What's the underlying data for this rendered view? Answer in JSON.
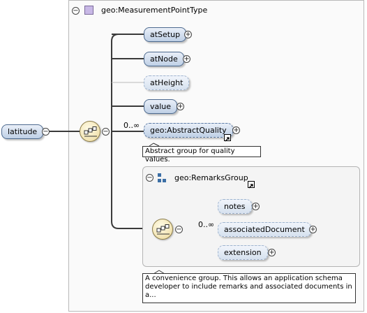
{
  "root": {
    "label": "latitude"
  },
  "complex_type": {
    "label": "geo:MeasurementPointType"
  },
  "elements": [
    {
      "label": "atSetup"
    },
    {
      "label": "atNode"
    },
    {
      "label": "atHeight"
    },
    {
      "label": "value"
    }
  ],
  "abstract_group": {
    "label": "geo:AbstractQuality",
    "cardinality": "0..∞",
    "tooltip": "Abstract group for quality values."
  },
  "remarks_group": {
    "label": "geo:RemarksGroup",
    "cardinality": "0..∞",
    "items": [
      {
        "label": "notes"
      },
      {
        "label": "associatedDocument"
      },
      {
        "label": "extension"
      }
    ],
    "tooltip": "A convenience group. This allows an application schema developer to include remarks and associated documents in a..."
  },
  "glyphs": {
    "collapse": "−",
    "expand": "+"
  }
}
